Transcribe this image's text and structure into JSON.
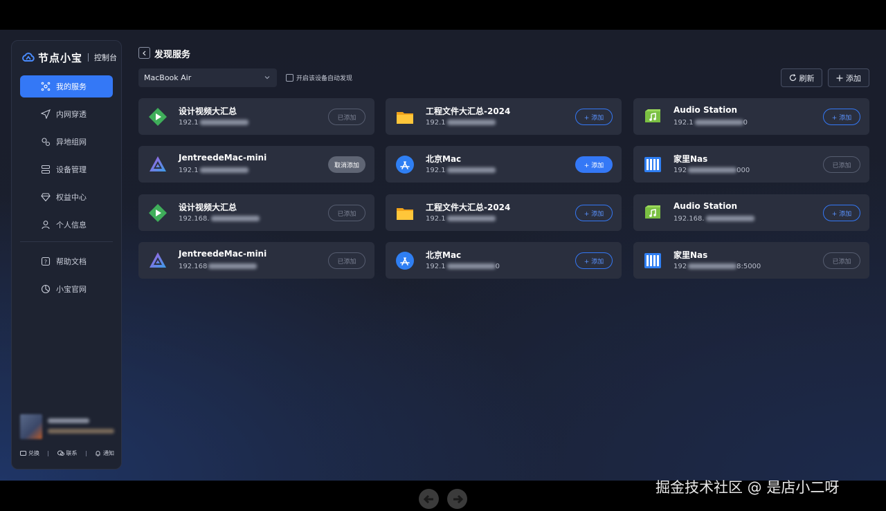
{
  "brand": {
    "name": "节点小宝",
    "sub": "控制台"
  },
  "nav": [
    {
      "label": "我的服务",
      "icon": "services-icon",
      "active": true
    },
    {
      "label": "内网穿透",
      "icon": "send-icon"
    },
    {
      "label": "异地组网",
      "icon": "network-icon"
    },
    {
      "label": "设备管理",
      "icon": "device-icon"
    },
    {
      "label": "权益中心",
      "icon": "diamond-icon"
    },
    {
      "label": "个人信息",
      "icon": "user-icon"
    },
    {
      "label": "帮助文档",
      "icon": "help-icon"
    },
    {
      "label": "小宝官网",
      "icon": "website-icon"
    }
  ],
  "footer": {
    "exchange": "兑换",
    "contact": "联系",
    "notify": "通知"
  },
  "header": {
    "title": "发现服务",
    "device_select": "MacBook Air",
    "auto_discover_label": "开启该设备自动发现",
    "refresh_label": "刷新",
    "add_label": "添加"
  },
  "cards": [
    {
      "title": "设计视频大汇总",
      "ip": "192.1",
      "icon": "play-icon",
      "button": "已添加",
      "state": "added"
    },
    {
      "title": "工程文件大汇总-2024",
      "ip": "192.1",
      "icon": "folder-icon",
      "button": "+ 添加",
      "state": "add"
    },
    {
      "title": "Audio Station",
      "ip": "192.1",
      "ip_tail": "0",
      "icon": "audio-station-icon",
      "button": "+ 添加",
      "state": "add"
    },
    {
      "title": "JentreedeMac-mini",
      "ip": "192.1",
      "icon": "jellyfin-icon",
      "button": "取消添加",
      "state": "cancel"
    },
    {
      "title": "北京Mac",
      "ip": "192.1",
      "icon": "app-store-icon",
      "button": "+ 添加",
      "state": "add-fill"
    },
    {
      "title": "家里Nas",
      "ip": "192",
      "ip_tail": "000",
      "icon": "nas-icon",
      "button": "已添加",
      "state": "added"
    },
    {
      "title": "设计视频大汇总",
      "ip": "192.168.",
      "icon": "play-icon",
      "button": "已添加",
      "state": "added"
    },
    {
      "title": "工程文件大汇总-2024",
      "ip": "192.1",
      "icon": "folder-icon",
      "button": "+ 添加",
      "state": "add"
    },
    {
      "title": "Audio Station",
      "ip": "192.168.",
      "icon": "audio-station-icon",
      "button": "+ 添加",
      "state": "add"
    },
    {
      "title": "JentreedeMac-mini",
      "ip": "192.168",
      "icon": "jellyfin-icon",
      "button": "已添加",
      "state": "added"
    },
    {
      "title": "北京Mac",
      "ip": "192.1",
      "ip_tail": "0",
      "icon": "app-store-icon",
      "button": "+ 添加",
      "state": "add"
    },
    {
      "title": "家里Nas",
      "ip": "192",
      "ip_tail": "8:5000",
      "icon": "nas-icon",
      "button": "已添加",
      "state": "added"
    }
  ],
  "watermark": "掘金技术社区 @ 是店小二呀",
  "colors": {
    "accent": "#3478f6",
    "card": "#2a2f3e",
    "sidebar": "#1e2331"
  }
}
